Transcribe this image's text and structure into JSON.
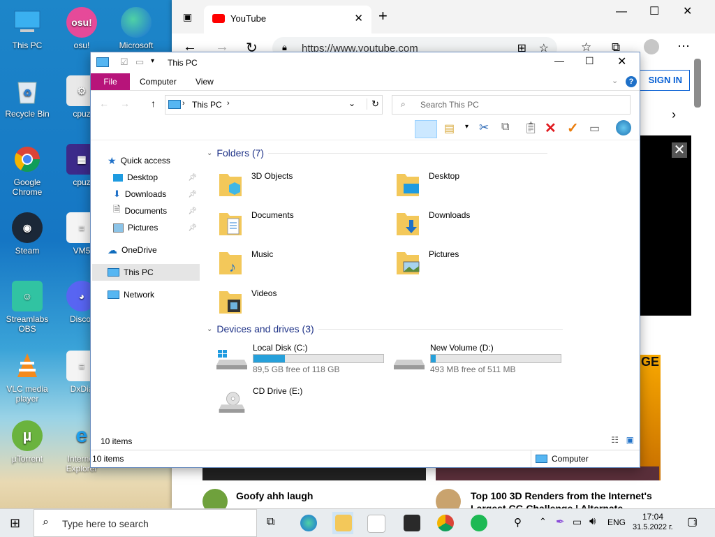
{
  "desktop": {
    "icons": [
      {
        "label": "This PC",
        "icon": "this-pc-icon"
      },
      {
        "label": "osu!",
        "icon": "osu-icon"
      },
      {
        "label": "Microsoft",
        "icon": "edge-icon"
      },
      {
        "label": "Recycle Bin",
        "icon": "recycle-bin-icon"
      },
      {
        "label": "cpuz",
        "icon": "cpuz-icon"
      },
      {
        "label": "Google Chrome",
        "icon": "chrome-icon"
      },
      {
        "label": "cpuz",
        "icon": "cpuz-chip-icon"
      },
      {
        "label": "Steam",
        "icon": "steam-icon"
      },
      {
        "label": "VM5",
        "icon": "file-icon"
      },
      {
        "label": "Streamlabs OBS",
        "icon": "streamlabs-icon"
      },
      {
        "label": "Discor",
        "icon": "discord-icon"
      },
      {
        "label": "VLC media player",
        "icon": "vlc-icon"
      },
      {
        "label": "DxDia",
        "icon": "file-icon"
      },
      {
        "label": "µTorrent",
        "icon": "utorrent-icon"
      },
      {
        "label": "Internet Explorer",
        "icon": "ie-icon"
      }
    ]
  },
  "browser": {
    "tab_title": "YouTube",
    "url": "https://www.youtube.com",
    "sign_in": "SIGN IN",
    "video1_title": "Goofy ahh laugh",
    "video2_title": "Top 100 3D Renders from the Internet's",
    "video2_subtitle": "Largest CG Challenge | Alternate",
    "thumb_text": "GE"
  },
  "explorer": {
    "title": "This PC",
    "ribbon_tabs": [
      "File",
      "Computer",
      "View"
    ],
    "breadcrumb": "This PC",
    "search_placeholder": "Search This PC",
    "nav": {
      "quick_access": "Quick access",
      "desktop": "Desktop",
      "downloads": "Downloads",
      "documents": "Documents",
      "pictures": "Pictures",
      "onedrive": "OneDrive",
      "this_pc": "This PC",
      "network": "Network"
    },
    "folders_header": "Folders (7)",
    "folders": [
      "3D Objects",
      "Desktop",
      "Documents",
      "Downloads",
      "Music",
      "Pictures",
      "Videos"
    ],
    "drives_header": "Devices and drives (3)",
    "drives": [
      {
        "name": "Local Disk (C:)",
        "free": "89,5 GB free of 118 GB",
        "used_fraction": 0.24
      },
      {
        "name": "New Volume (D:)",
        "free": "493 MB free of 511 MB",
        "used_fraction": 0.035
      },
      {
        "name": "CD Drive (E:)",
        "free": "",
        "used_fraction": 0
      }
    ],
    "status_items": "10 items",
    "status_items2": "10 items",
    "status_location": "Computer"
  },
  "taskbar": {
    "search_placeholder": "Type here to search",
    "lang": "ENG",
    "time": "17:04",
    "date": "31.5.2022 г.",
    "notifications": "1"
  },
  "colors": {
    "file_tab": "#b7147a",
    "accent": "#26a0da",
    "group_header": "#1e3287"
  }
}
